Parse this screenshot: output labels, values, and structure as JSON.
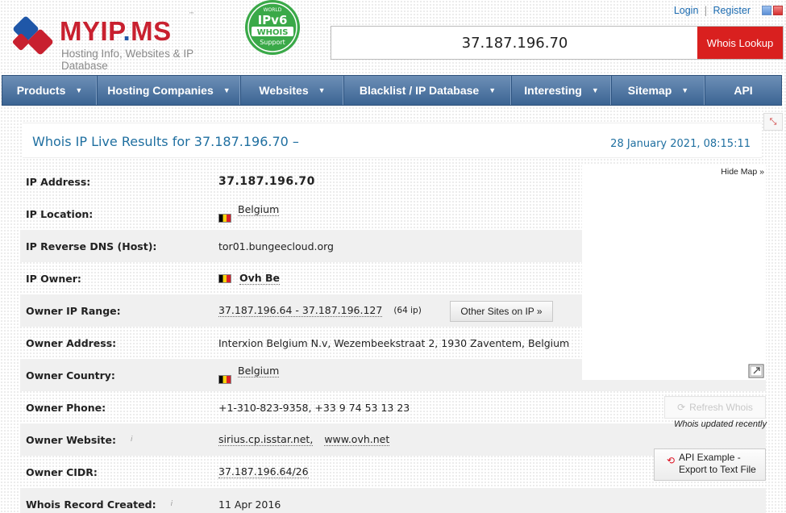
{
  "header": {
    "logo_text": "MYIP",
    "logo_dot": ".",
    "logo_text2": "MS",
    "logo_tm": "™",
    "tagline": "Hosting Info, Websites & IP Database",
    "badge": {
      "top": "WORLD",
      "line1": "IPv6",
      "line2": "WHOIS",
      "line3": "Support"
    },
    "login": "Login",
    "separator": "|",
    "register": "Register",
    "search_value": "37.187.196.70",
    "search_button": "Whois Lookup"
  },
  "nav": [
    {
      "label": "Products",
      "caret": "▼"
    },
    {
      "label": "Hosting Companies",
      "caret": "▼"
    },
    {
      "label": "Websites",
      "caret": "▼"
    },
    {
      "label": "Blacklist / IP Database",
      "caret": "▼"
    },
    {
      "label": "Interesting",
      "caret": "▼"
    },
    {
      "label": "Sitemap",
      "caret": "▼"
    },
    {
      "label": "API",
      "caret": ""
    }
  ],
  "result": {
    "title": "Whois IP Live Results for 37.187.196.70 –",
    "date": "28 January 2021, 08:15:11",
    "hide_map": "Hide Map »"
  },
  "rows": {
    "ip_address": {
      "label": "IP Address:",
      "value": "37.187.196.70"
    },
    "ip_location": {
      "label": "IP Location:",
      "value": "Belgium"
    },
    "reverse_dns": {
      "label": "IP Reverse DNS (Host):",
      "value": "tor01.bungeecloud.org"
    },
    "ip_owner": {
      "label": "IP Owner:",
      "value": "Ovh Be"
    },
    "owner_range": {
      "label": "Owner IP Range:",
      "value": "37.187.196.64 - 37.187.196.127",
      "count": "(64 ip)",
      "button": "Other Sites on IP »"
    },
    "owner_address": {
      "label": "Owner Address:",
      "value": "Interxion Belgium N.v, Wezembeekstraat 2, 1930 Zaventem, Belgium"
    },
    "owner_country": {
      "label": "Owner Country:",
      "value": "Belgium"
    },
    "owner_phone": {
      "label": "Owner Phone:",
      "value": "+1-310-823-9358, +33 9 74 53 13 23"
    },
    "owner_website": {
      "label": "Owner Website:",
      "info": "i",
      "value1": "sirius.cp.isstar.net,",
      "value2": "www.ovh.net"
    },
    "owner_cidr": {
      "label": "Owner CIDR:",
      "value": "37.187.196.64/26"
    },
    "record_created": {
      "label": "Whois Record Created:",
      "info": "i",
      "value": "11 Apr 2016"
    }
  },
  "side": {
    "refresh": "Refresh Whois",
    "updated": "Whois updated recently",
    "api_line1": "API Example -",
    "api_line2": "Export to Text File"
  },
  "colors": {
    "brand_red": "#d9201f",
    "nav_blue": "#3b6493",
    "link_blue": "#1f6fa0"
  }
}
